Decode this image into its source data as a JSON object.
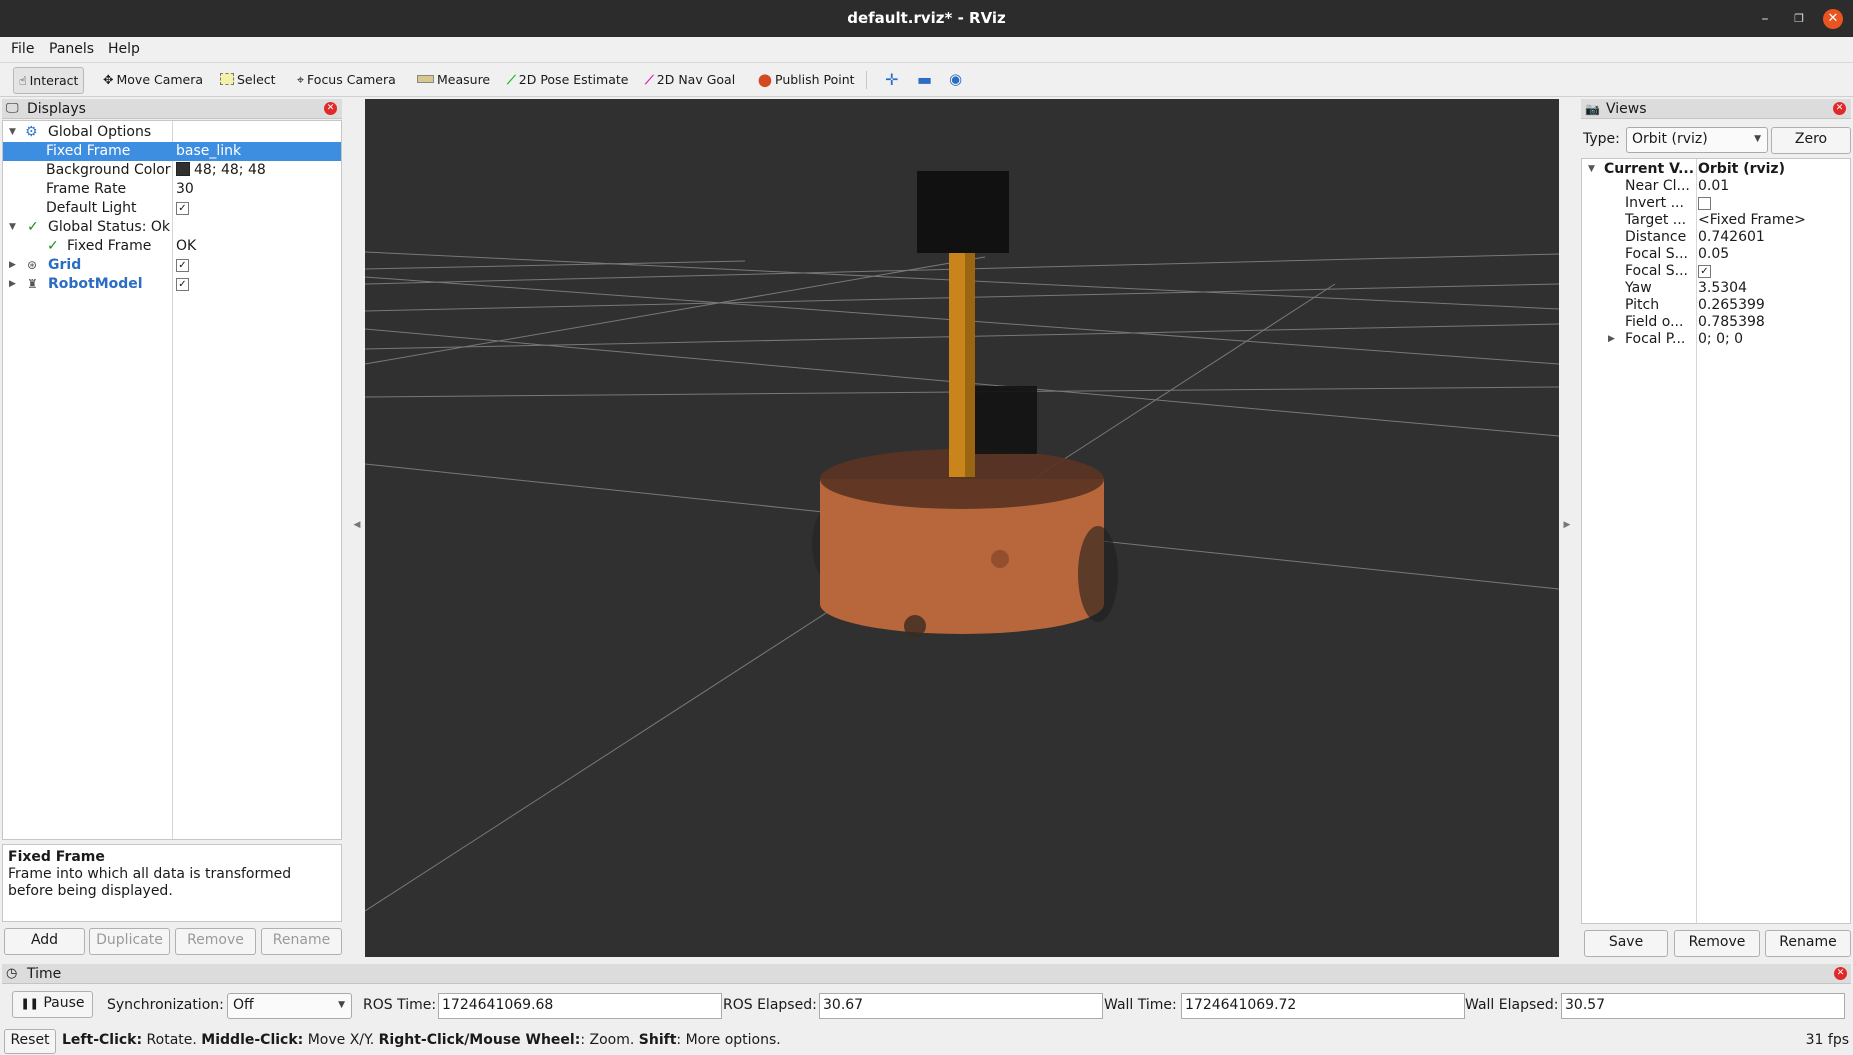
{
  "window": {
    "title": "default.rviz* - RViz"
  },
  "menu": [
    "File",
    "Panels",
    "Help"
  ],
  "toolbar": {
    "interact": "Interact",
    "move_camera": "Move Camera",
    "select": "Select",
    "focus_camera": "Focus Camera",
    "measure": "Measure",
    "pose_estimate": "2D Pose Estimate",
    "nav_goal": "2D Nav Goal",
    "publish_point": "Publish Point"
  },
  "displays": {
    "title": "Displays",
    "global_options": "Global Options",
    "fixed_frame_label": "Fixed Frame",
    "fixed_frame_value": "base_link",
    "bg_color_label": "Background Color",
    "bg_color_value": "48; 48; 48",
    "frame_rate_label": "Frame Rate",
    "frame_rate_value": "30",
    "default_light_label": "Default Light",
    "global_status": "Global Status: Ok",
    "status_fixed_frame": "Fixed Frame",
    "status_fixed_frame_value": "OK",
    "grid": "Grid",
    "robot_model": "RobotModel",
    "check": "✓"
  },
  "description": {
    "title": "Fixed Frame",
    "text": "Frame into which all data is transformed before being displayed."
  },
  "display_buttons": {
    "add": "Add",
    "duplicate": "Duplicate",
    "remove": "Remove",
    "rename": "Rename"
  },
  "views": {
    "title": "Views",
    "type_label": "Type:",
    "type_value": "Orbit (rviz)",
    "zero": "Zero",
    "current_label": "Current V...",
    "current_value": "Orbit (rviz)",
    "props": [
      {
        "k": "Near Cl...",
        "v": "0.01"
      },
      {
        "k": "Invert ...",
        "v": ""
      },
      {
        "k": "Target ...",
        "v": "<Fixed Frame>"
      },
      {
        "k": "Distance",
        "v": "0.742601"
      },
      {
        "k": "Focal S...",
        "v": "0.05"
      },
      {
        "k": "Focal S...",
        "v": ""
      },
      {
        "k": "Yaw",
        "v": "3.5304"
      },
      {
        "k": "Pitch",
        "v": "0.265399"
      },
      {
        "k": "Field o...",
        "v": "0.785398"
      },
      {
        "k": "Focal P...",
        "v": "0; 0; 0"
      }
    ],
    "save": "Save",
    "remove": "Remove",
    "rename": "Rename"
  },
  "time": {
    "title": "Time",
    "pause": "Pause",
    "sync_label": "Synchronization:",
    "sync_value": "Off",
    "ros_time_label": "ROS Time:",
    "ros_time": "1724641069.68",
    "ros_elapsed_label": "ROS Elapsed:",
    "ros_elapsed": "30.67",
    "wall_time_label": "Wall Time:",
    "wall_time": "1724641069.72",
    "wall_elapsed_label": "Wall Elapsed:",
    "wall_elapsed": "30.57"
  },
  "status": {
    "reset": "Reset",
    "b1": "Left-Click:",
    "t1": "Rotate.",
    "b2": "Middle-Click:",
    "t2": "Move X/Y.",
    "b3": "Right-Click/Mouse Wheel:",
    "t3": ": Zoom.",
    "b4": "Shift",
    "t4": ": More options.",
    "fps": "31 fps"
  }
}
